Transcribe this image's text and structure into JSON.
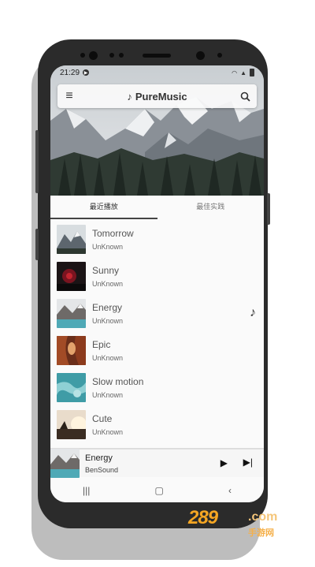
{
  "status_bar": {
    "time": "21:29"
  },
  "app_bar": {
    "title": "PureMusic"
  },
  "tabs": [
    {
      "label": "最近播放",
      "active": true
    },
    {
      "label": "最佳实践",
      "active": false
    }
  ],
  "songs": [
    {
      "title": "Tomorrow",
      "artist": "UnKnown",
      "thumb": "mountains"
    },
    {
      "title": "Sunny",
      "artist": "UnKnown",
      "thumb": "red-night"
    },
    {
      "title": "Energy",
      "artist": "UnKnown",
      "thumb": "lake-mountains",
      "playing": true
    },
    {
      "title": "Epic",
      "artist": "UnKnown",
      "thumb": "canyon"
    },
    {
      "title": "Slow motion",
      "artist": "UnKnown",
      "thumb": "ice-water"
    },
    {
      "title": "Cute",
      "artist": "UnKnown",
      "thumb": "sunset"
    }
  ],
  "player": {
    "title": "Energy",
    "artist": "BenSound"
  },
  "watermark": {
    "main": "289",
    "domain": ".com",
    "sub": "手游网"
  },
  "colors": {
    "accent": "#444444",
    "watermark": "#f5a623"
  }
}
